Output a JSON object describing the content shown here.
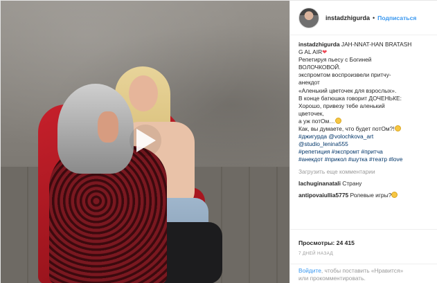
{
  "post": {
    "username": "instadzhigurda",
    "follow_label": "Подписаться",
    "dot": "•",
    "caption_lines": [
      "JAH-NNAT-HAN BRATASH",
      "G AL AIR",
      "Репетируя пьесу с Богиней",
      "ВОЛОЧКОВОЙ.",
      "экспромтом воспроизвели притчу-",
      "анекдот",
      "«Аленький цветочек для взрослых».",
      "В конце батюшка говорит ДОЧЕНЬКЕ:",
      "Хорошо, привезу тебе аленький",
      "цветочек,",
      "а уж потОм…",
      "Как, вы думаете, что будет потОм?!"
    ],
    "tags": {
      "line1_a": "#джигурда",
      "line1_b": "@volochkova_art",
      "line2": "@studio_lenina555",
      "line3": [
        "#репетиция",
        "#экспромт",
        "#притча"
      ],
      "line4": [
        "#анекдот",
        "#прикол",
        "#шутка",
        "#театр",
        "#love"
      ]
    },
    "load_more": "Загрузить еще комментарии",
    "comments": [
      {
        "user": "lachuginanatali",
        "text": "Страну"
      },
      {
        "user": "antipovaiullia5775",
        "text": "Ролевые игры?"
      }
    ],
    "views": "Просмотры: 24 415",
    "date": "7 ДНЕЙ НАЗАД",
    "login_link": "Войдите",
    "login_text_a": ", чтобы поставить «Нравится»",
    "login_text_b": "или прокомментировать."
  },
  "icons": {
    "play": "play-icon",
    "heart": "heart-icon",
    "emoji": "grinning-emoji-icon"
  },
  "colors": {
    "accent": "#3897f0",
    "text": "#262626",
    "muted": "#999999",
    "heart": "#ed4956",
    "chair": "#c6202b"
  }
}
